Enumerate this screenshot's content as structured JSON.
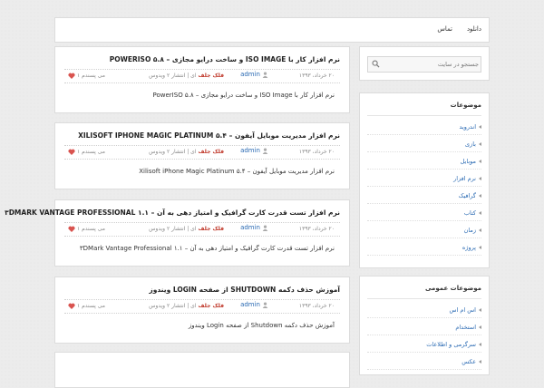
{
  "nav": {
    "download": "دانلود",
    "contact": "تماس"
  },
  "search": {
    "placeholder": "جستجو در سایت"
  },
  "posts": [
    {
      "title": "نرم افزار کار با ISO IMAGE و ساخت درایو مجازی – POWERISO ۵.۸",
      "date": "۲۰ خرداد، ۱۳۹۳",
      "author": "admin",
      "cat_hot": "فلک جلف",
      "cat_rest": "ای | انتشار ۲ ویدوس",
      "likes": "۱ می پسندم",
      "excerpt": "نرم افزار کار با ISO Image و ساخت درایو مجازی – PowerISO ۵.۸"
    },
    {
      "title": "نرم افزار مدیریت موبایل آیفون – XILISOFT IPHONE MAGIC PLATINUM ۵.۴",
      "date": "۲۰ خرداد، ۱۳۹۳",
      "author": "admin",
      "cat_hot": "فلک جلف",
      "cat_rest": "ای | انتشار ۲ ویدوس",
      "likes": "۱ می پسندم",
      "excerpt": "نرم افزار مدیریت موبایل آیفون – Xilisoft iPhone Magic Platinum ۵.۴"
    },
    {
      "title": "نرم افزار تست قدرت کارت گرافیک و امتیاز دهی به آن – ۳DMARK VANTAGE PROFESSIONAL ۱.۱",
      "date": "۲۰ خرداد، ۱۳۹۳",
      "author": "admin",
      "cat_hot": "فلک جلف",
      "cat_rest": "ای | انتشار ۲ ویدوس",
      "likes": "۱ می پسندم",
      "excerpt": "نرم افزار تست قدرت کارت گرافیک و امتیاز دهی به آن – ۳DMark Vantage Professional ۱.۱"
    },
    {
      "title": "آموزش حذف دکمه SHUTDOWN از صفحه LOGIN ویندوز",
      "date": "۲۰ خرداد، ۱۳۹۳",
      "author": "admin",
      "cat_hot": "فلک جلف",
      "cat_rest": "ای | انتشار ۲ ویدوس",
      "likes": "۱ می پسندم",
      "excerpt": "آموزش حذف دکمه Shutdown از صفحه Login ویندوز"
    }
  ],
  "widgets": {
    "categories": {
      "title": "موضوعات",
      "items": [
        "اندروید",
        "بازی",
        "موبایل",
        "نرم افزار",
        "گرافیک",
        "کتاب",
        "زمان",
        "پروژه"
      ]
    },
    "general": {
      "title": "موضوعات عمومی",
      "items": [
        "اس ام اس",
        "استخدام",
        "سرگرمی و اطلاعات",
        "عکس"
      ]
    }
  }
}
